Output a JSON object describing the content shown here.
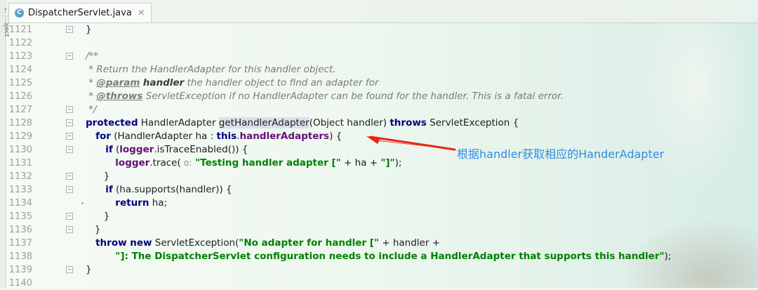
{
  "tab": {
    "icon": "C",
    "filename": "DispatcherServlet.java",
    "close": "×"
  },
  "side_tool_window": "1: Project",
  "annotation": "根据handler获取相应的HanderAdapter",
  "colors": {
    "keyword": "#000080",
    "string": "#008000",
    "field": "#660e7a",
    "comment": "#7a7a7a",
    "annotation": "#2f8de4",
    "arrow": "#e8261a"
  },
  "lines": [
    {
      "n": "1121",
      "t": "}"
    },
    {
      "n": "1122"
    },
    {
      "n": "1123",
      "t": "/**"
    },
    {
      "n": "1124",
      "t": " * Return the HandlerAdapter for this handler object."
    },
    {
      "n": "1125",
      "a": " * ",
      "b": "@param",
      "c": "handler",
      "d": " the handler object to find an adapter for"
    },
    {
      "n": "1126",
      "a": " * ",
      "b": "@throws",
      "c": "ServletException",
      "d": " if no HandlerAdapter can be found for the handler. This is a fatal error."
    },
    {
      "n": "1127",
      "t": " */"
    },
    {
      "n": "1128",
      "a": "protected",
      "b": " HandlerAdapter ",
      "c": "getHandlerAdapter",
      "d": "(Object handler) ",
      "e": "throws",
      "f": " ServletException {"
    },
    {
      "n": "1129",
      "a": "   for",
      "b": " (HandlerAdapter ha : ",
      "c": "this",
      "d": ".",
      "e": "handlerAdapters",
      "f": ") {"
    },
    {
      "n": "1130",
      "a": "      if",
      "b": " (",
      "c": "logger",
      "d": ".isTraceEnabled()) {"
    },
    {
      "n": "1131",
      "a": "         logger",
      "b": ".trace( ",
      "c": "o:",
      "d": " \"Testing handler adapter [\"",
      "e": " + ha + ",
      "f": "\"]\"",
      "g": ");"
    },
    {
      "n": "1132",
      "t": "      }"
    },
    {
      "n": "1133",
      "a": "      if",
      "b": " (ha.supports(handler)) {"
    },
    {
      "n": "1134",
      "a": "         return",
      "b": " ha;"
    },
    {
      "n": "1135",
      "t": "      }"
    },
    {
      "n": "1136",
      "t": "   }"
    },
    {
      "n": "1137",
      "a": "   throw new",
      "b": " ServletException(",
      "c": "\"No adapter for handler [\"",
      "d": " + handler +"
    },
    {
      "n": "1138",
      "a": "         \"]: The DispatcherServlet configuration needs to include a HandlerAdapter that supports this handler\"",
      "b": ");"
    },
    {
      "n": "1139",
      "t": "}"
    },
    {
      "n": "1140"
    }
  ]
}
